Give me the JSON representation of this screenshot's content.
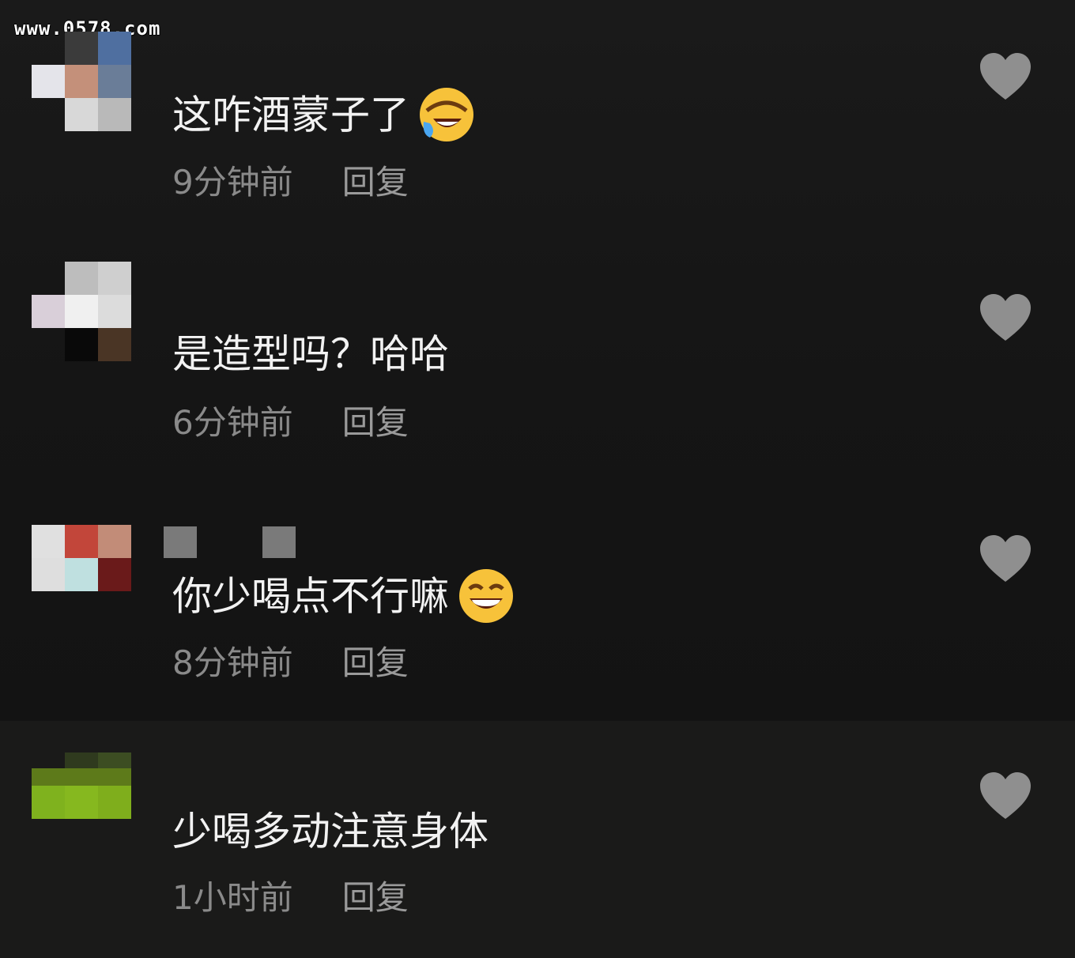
{
  "watermark": "www.0578.com",
  "comments": [
    {
      "text": "这咋酒蒙子了",
      "emoji": "rolling-on-floor-laughing-emoji",
      "time": "9分钟前",
      "reply": "回复",
      "like_icon": "heart-icon"
    },
    {
      "text": "是造型吗？哈哈",
      "time": "6分钟前",
      "reply": "回复",
      "like_icon": "heart-icon"
    },
    {
      "text": "你少喝点不行嘛",
      "emoji": "grinning-face-emoji",
      "time": "8分钟前",
      "reply": "回复",
      "like_icon": "heart-icon"
    },
    {
      "text": "少喝多动注意身体",
      "time": "1小时前",
      "reply": "回复",
      "like_icon": "heart-icon"
    }
  ],
  "colors": {
    "background": "#161616",
    "comment_text": "#f2f2f2",
    "meta_text": "#8a8a8a",
    "heart": "#8f8f8f"
  }
}
